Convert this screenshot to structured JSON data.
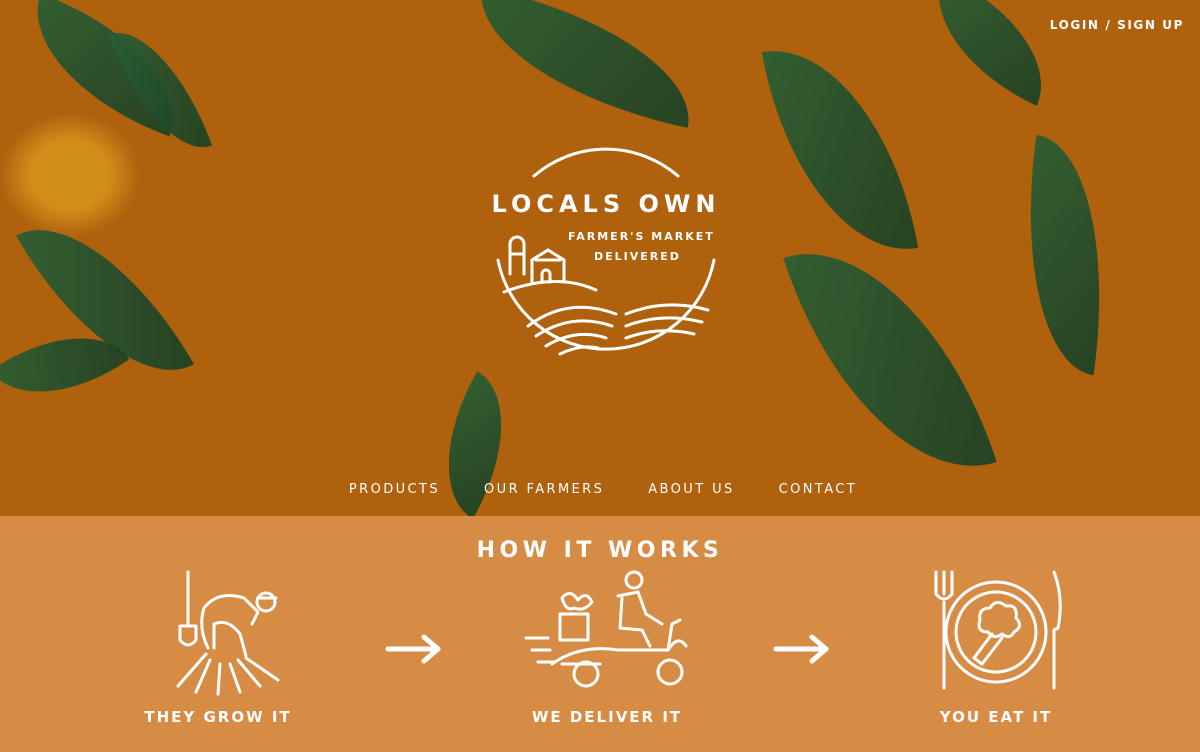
{
  "header": {
    "login_label": "LOGIN / SIGN UP"
  },
  "logo": {
    "name": "LOCALS OWN",
    "tagline_line1": "FARMER'S MARKET",
    "tagline_line2": "DELIVERED",
    "icon": "farm-landscape-icon"
  },
  "nav": {
    "items": [
      "PRODUCTS",
      "OUR FARMERS",
      "ABOUT US",
      "CONTACT"
    ]
  },
  "how_it_works": {
    "title": "HOW IT WORKS",
    "steps": [
      {
        "label": "THEY GROW IT",
        "icon": "farmer-with-shovel-icon"
      },
      {
        "label": "WE DELIVER IT",
        "icon": "delivery-scooter-icon"
      },
      {
        "label": "YOU EAT IT",
        "icon": "plate-with-broccoli-icon"
      }
    ],
    "arrow_icon": "right-arrow-icon"
  },
  "colors": {
    "accent": "#d78c45",
    "text": "#ffffff",
    "foliage": "#2d5a36",
    "fruit": "#f0a01e"
  }
}
